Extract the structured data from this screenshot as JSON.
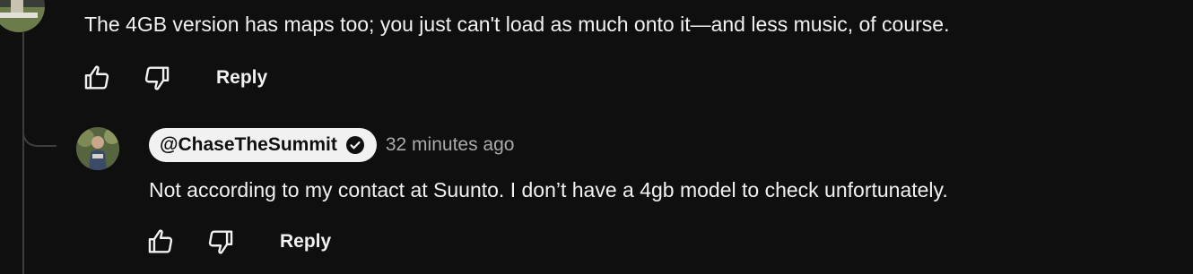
{
  "parent_comment": {
    "text": "The 4GB version has maps too; you just can't load as much onto it—and less music, of course.",
    "reply_label": "Reply"
  },
  "reply_comment": {
    "author": "@ChaseTheSummit",
    "timestamp": "32 minutes ago",
    "text": "Not according to my contact at Suunto. I don’t have a 4gb model to check unfortunately.",
    "reply_label": "Reply"
  },
  "icons": {
    "like": "thumbs-up-icon",
    "dislike": "thumbs-down-icon",
    "verified": "verified-check-icon"
  },
  "colors": {
    "background": "#0f0f0f",
    "text": "#f1f1f1",
    "muted": "#aaaaaa",
    "chip": "#f1f1f1",
    "thread_line": "#3d3d3d"
  }
}
